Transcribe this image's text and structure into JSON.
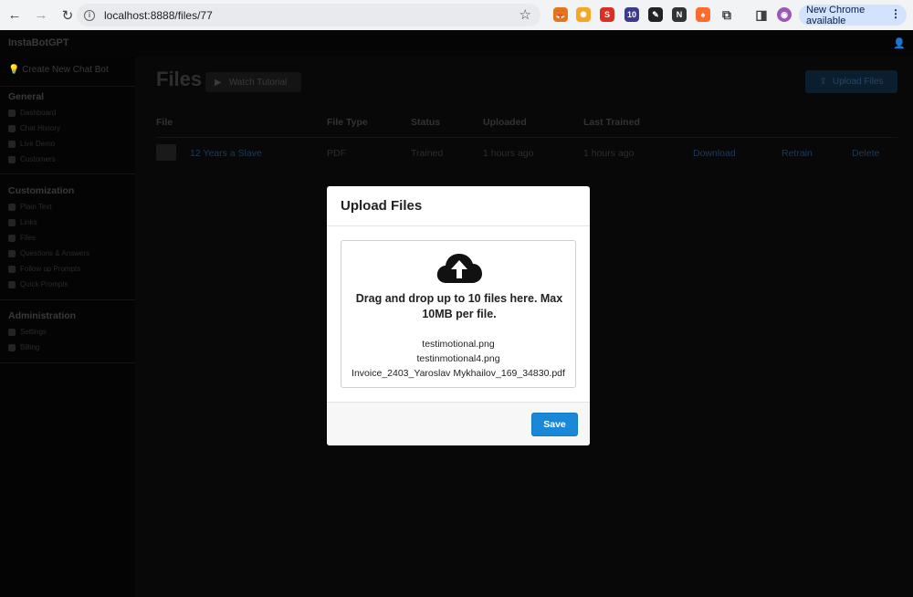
{
  "browser": {
    "url": "localhost:8888/files/77",
    "update_label": "New Chrome available",
    "extension_badge": "10"
  },
  "app": {
    "brand": "InstaBotGPT",
    "create_bot": "Create New Chat Bot"
  },
  "sidebar": {
    "general_title": "General",
    "general_items": [
      {
        "label": "Dashboard",
        "icon": "dashboard-icon"
      },
      {
        "label": "Chat History",
        "icon": "chat-icon"
      },
      {
        "label": "Live Demo",
        "icon": "question-icon"
      },
      {
        "label": "Customers",
        "icon": "users-icon"
      }
    ],
    "customization_title": "Customization",
    "customization_items": [
      {
        "label": "Plain Text",
        "icon": "file-icon"
      },
      {
        "label": "Links",
        "icon": "link-icon"
      },
      {
        "label": "Files",
        "icon": "files-icon"
      },
      {
        "label": "Questions & Answers",
        "icon": "qa-icon"
      },
      {
        "label": "Follow up Prompts",
        "icon": "refresh-icon"
      },
      {
        "label": "Quick Prompts",
        "icon": "bolt-icon"
      }
    ],
    "administration_title": "Administration",
    "administration_items": [
      {
        "label": "Settings",
        "icon": "gear-icon"
      },
      {
        "label": "Billing",
        "icon": "card-icon"
      }
    ]
  },
  "main": {
    "title": "Files",
    "watch_tutorial": "Watch Tutorial",
    "upload_files": "Upload Files",
    "columns": [
      "File",
      "File Type",
      "Status",
      "Uploaded",
      "Last Trained"
    ],
    "rows": [
      {
        "file": "12 Years a Slave",
        "type": "PDF",
        "status": "Trained",
        "uploaded": "1 hours ago",
        "last_trained": "1 hours ago",
        "download": "Download",
        "retrain": "Retrain",
        "delete": "Delete"
      }
    ]
  },
  "modal": {
    "title": "Upload Files",
    "dropzone_text": "Drag and drop up to 10 files here. Max 10MB per file.",
    "files": [
      "testimotional.png",
      "testinmotional4.png",
      "Invoice_2403_Yaroslav Mykhailov_169_34830.pdf"
    ],
    "save_label": "Save"
  },
  "colors": {
    "accent": "#1a88d8",
    "chrome_bg": "#f1f3f4",
    "update_pill": "#d3e3fd"
  }
}
